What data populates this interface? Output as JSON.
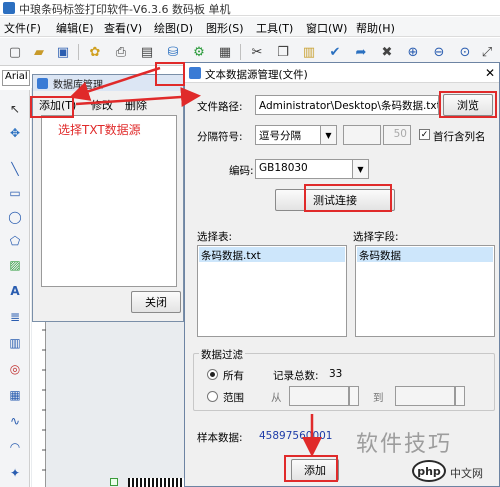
{
  "app": {
    "title": "中琅条码标签打印软件-V6.3.6 数码板 单机",
    "menus": [
      "文件(F)",
      "编辑(E)",
      "查看(V)",
      "绘图(D)",
      "图形(S)",
      "工具(T)",
      "窗口(W)",
      "帮助(H)"
    ],
    "font_combo": "Arial"
  },
  "datasource_window": {
    "title": "数据库管理",
    "menu": [
      "添加(T)",
      "修改",
      "删除"
    ],
    "close_label": "关闭",
    "annotation": "选择TXT数据源"
  },
  "dialog": {
    "title": "文本数据源管理(文件)",
    "file_path_label": "文件路径:",
    "file_path_value": "Administrator\\Desktop\\条码数据.txt",
    "browse_label": "浏览",
    "delimiter_label": "分隔符号:",
    "delimiter_value": "逗号分隔",
    "delimiter_extra": "",
    "delimiter_num": "50",
    "header_row_label": "首行含列名",
    "header_row_checked": true,
    "encoding_label": "编码:",
    "encoding_value": "GB18030",
    "test_button": "测试连接",
    "tables_label": "选择表:",
    "tables": [
      "条码数据.txt"
    ],
    "fields_label": "选择字段:",
    "fields": [
      "条码数据"
    ],
    "filter_group": "数据过滤",
    "filter_all": "所有",
    "record_total_label": "记录总数:",
    "record_total": "33",
    "filter_range": "范围",
    "from_label": "从",
    "to_label": "到",
    "sample_label": "样本数据:",
    "sample_value": "45897560001",
    "add_button": "添加"
  },
  "watermark": {
    "text": "软件技巧",
    "logo": "php",
    "site": "中文网"
  },
  "colors": {
    "annotation_red": "#e02a2a",
    "sample_blue": "#1f3da8",
    "selection_blue": "#cde6fb"
  }
}
